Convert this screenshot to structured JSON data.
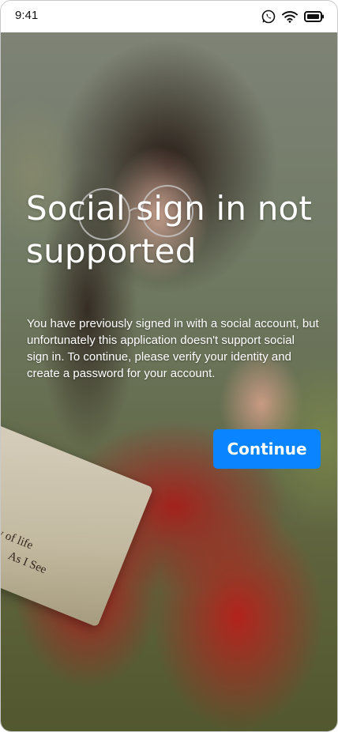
{
  "status_bar": {
    "time": "9:41",
    "icons": [
      "whatsapp-icon",
      "wifi-icon",
      "battery-icon"
    ]
  },
  "background": {
    "book_title": "Journey of life",
    "book_subtitle": "As I See"
  },
  "screen": {
    "title": "Social sign in not supported",
    "message": "You have previously signed in with a social account, but unfortunately this application doesn't support social sign in. To continue, please verify your identity and create a password for your account.",
    "continue_label": "Continue"
  },
  "colors": {
    "accent": "#0a84ff",
    "text": "#ffffff"
  }
}
